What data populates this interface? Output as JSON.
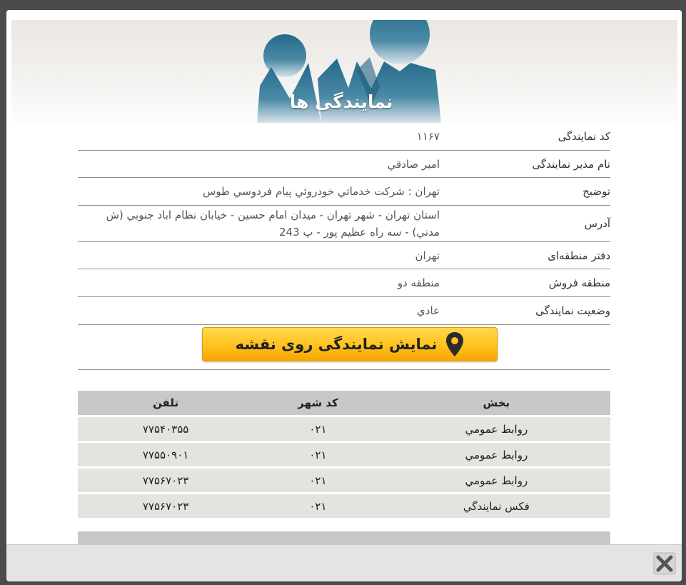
{
  "banner": {
    "title": "نمایندگی ها"
  },
  "info": {
    "rows": [
      {
        "label": "کد نمایندگی",
        "value": "۱۱۶۷"
      },
      {
        "label": "نام مدیر نمایندگی",
        "value": "امير صادقي"
      },
      {
        "label": "توضیح",
        "value": "تهران : شركت خدماتي خودروئي پيام فردوسي طوس"
      },
      {
        "label": "آدرس",
        "value": "استان تهران - شهر تهران - ميدان امام حسين - خيابان نظام اباد جنوبي (ش مدني) - سه راه عظيم پور - پ 243"
      },
      {
        "label": "دفتر منطقه‌ای",
        "value": "تهران"
      },
      {
        "label": "منطقه فروش",
        "value": "منطقه دو"
      },
      {
        "label": "وضعیت نمایندگی",
        "value": "عادي"
      }
    ],
    "map_button_label": "نمایش نمایندگی روی نقشه"
  },
  "phones": {
    "headers": {
      "section": "بخش",
      "city_code": "کد شهر",
      "phone": "تلفن"
    },
    "rows": [
      {
        "section": "روابط عمومي",
        "city_code": "۰۲۱",
        "phone": "۷۷۵۴۰۳۵۵"
      },
      {
        "section": "روابط عمومي",
        "city_code": "۰۲۱",
        "phone": "۷۷۵۵۰۹۰۱"
      },
      {
        "section": "روابط عمومي",
        "city_code": "۰۲۱",
        "phone": "۷۷۵۶۷۰۲۳"
      },
      {
        "section": "فكس نمايندگي",
        "city_code": "۰۲۱",
        "phone": "۷۷۵۶۷۰۲۳"
      }
    ]
  },
  "icons": {
    "pin": "map-pin-icon",
    "close": "close-icon"
  },
  "colors": {
    "button": "#ffc21e",
    "table_header": "#c8c8c8",
    "table_row": "#e3e3e0"
  }
}
